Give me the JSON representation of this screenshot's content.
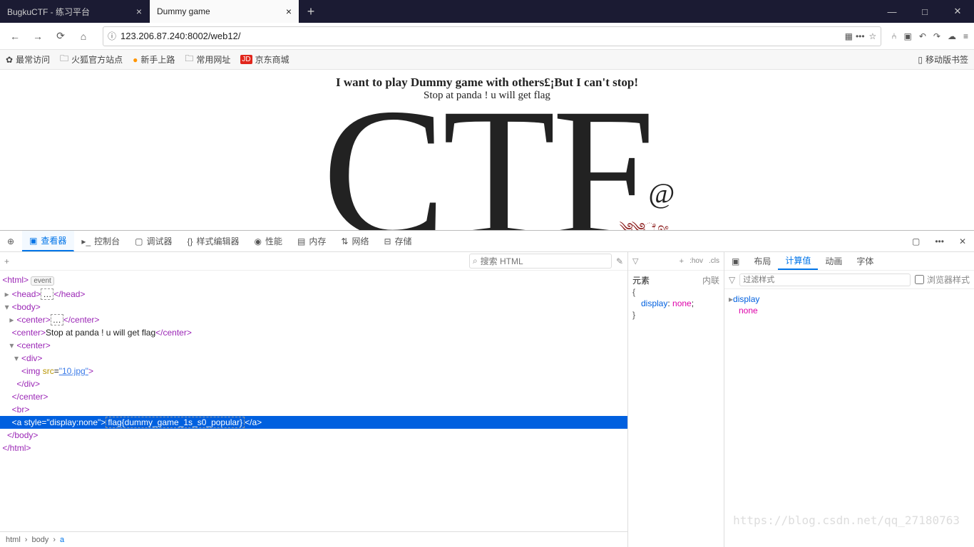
{
  "tabs": {
    "inactive": "BugkuCTF - 练习平台",
    "active": "Dummy game"
  },
  "url": "123.206.87.240:8002/web12/",
  "bookmarks": {
    "b0": "最常访问",
    "b1": "火狐官方站点",
    "b2": "新手上路",
    "b3": "常用网址",
    "b4": "京东商城",
    "right": "移动版书签"
  },
  "page": {
    "heading": "I want to play Dummy game with others£¡But I can't stop!",
    "sub": "Stop at panda ! u will get flag",
    "big": "CTF",
    "at": "@"
  },
  "devtabs": {
    "inspector": "查看器",
    "console": "控制台",
    "debugger": "调试器",
    "styleeditor": "样式编辑器",
    "performance": "性能",
    "memory": "内存",
    "network": "网络",
    "storage": "存储"
  },
  "search": {
    "placeholder": "搜索 HTML"
  },
  "tree": {
    "html_open": "<html>",
    "event": "event",
    "head_open": "<head>",
    "head_ell": "…",
    "head_close": "</head>",
    "body_open": "<body>",
    "center1_open": "<center>",
    "center1_ell": "…",
    "center1_close": "</center>",
    "center2_open": "<center>",
    "center2_text": "Stop at panda ! u will get flag",
    "center2_close": "</center>",
    "center3_open": "<center>",
    "div_open": "<div>",
    "img_tag_a": "<img ",
    "img_attr": "src",
    "img_eq": "=",
    "img_val": "\"10.jpg\"",
    "img_tag_b": ">",
    "div_close": "</div>",
    "center3_close": "</center>",
    "br": "<br>",
    "a_open_a": "<a ",
    "a_attr": "style",
    "a_eq": "=",
    "a_val": "\"display:none\"",
    "a_open_b": ">",
    "a_text": "flag{dummy_game_1s_s0_popular}",
    "a_close": "</a>",
    "body_close": "</body>",
    "html_close": "</html>"
  },
  "breadcrumb": {
    "a": "html",
    "b": "body",
    "c": "a"
  },
  "midpanel": {
    "element": "元素",
    "inline": "内联",
    "brace_open": "{",
    "prop": "display",
    "val": "none",
    "brace_close": "}",
    "hov": ":hov",
    "cls": ".cls"
  },
  "sidetabs": {
    "layout": "布局",
    "computed": "计算值",
    "animations": "动画",
    "fonts": "字体"
  },
  "filter": {
    "placeholder": "过滤样式",
    "browser": "浏览器样式"
  },
  "computed": {
    "prop": "display",
    "val": "none"
  },
  "watermark": "https://blog.csdn.net/qq_27180763"
}
